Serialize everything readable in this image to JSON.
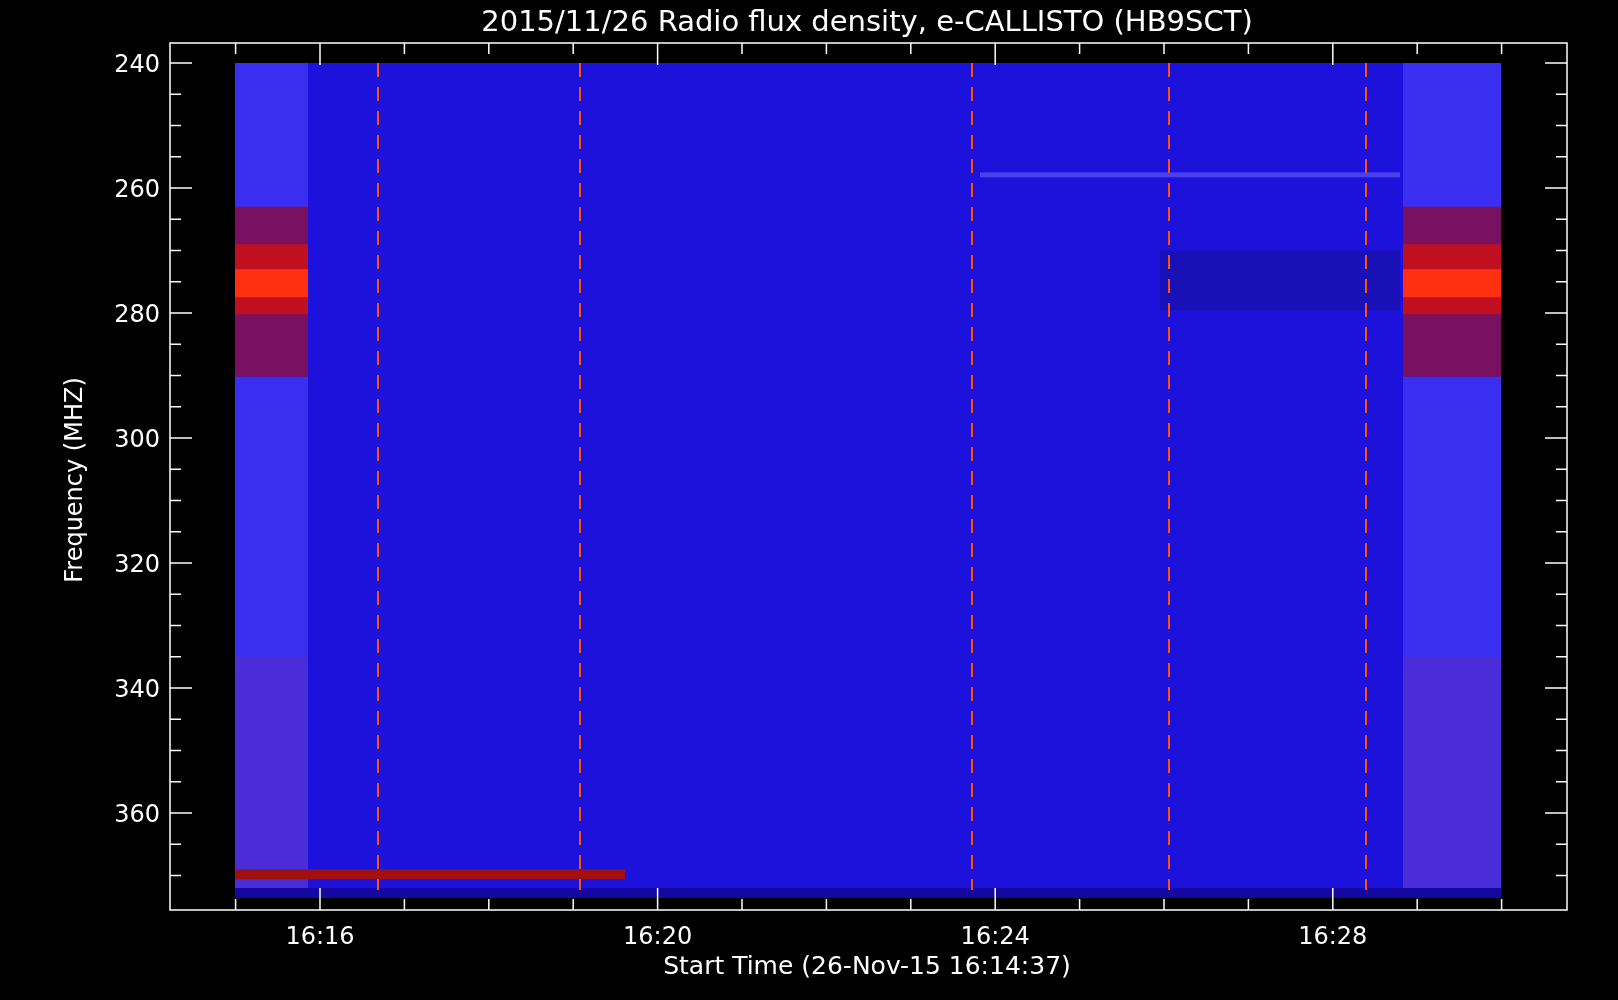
{
  "title": "2015/11/26  Radio flux density, e-CALLISTO (HB9SCT)",
  "y_axis": {
    "label": "Frequency (MHZ)",
    "ticks": [
      "240",
      "260",
      "280",
      "300",
      "320",
      "340",
      "360"
    ]
  },
  "x_axis": {
    "label": "Start Time (26-Nov-15 16:14:37)",
    "ticks": [
      "16:16",
      "16:20",
      "16:24",
      "16:28"
    ]
  }
}
